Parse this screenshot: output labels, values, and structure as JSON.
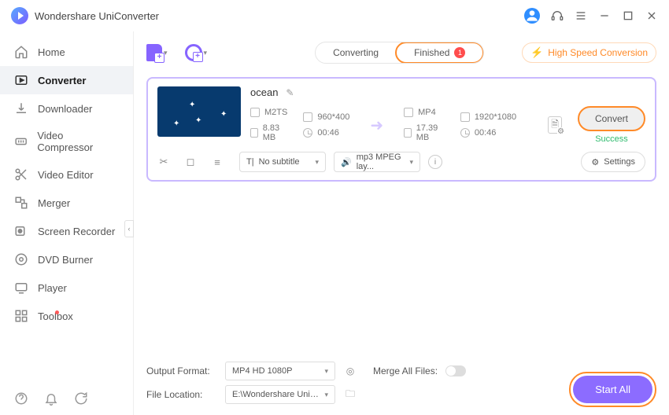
{
  "app": {
    "title": "Wondershare UniConverter"
  },
  "sidebar": {
    "items": [
      {
        "label": "Home"
      },
      {
        "label": "Converter"
      },
      {
        "label": "Downloader"
      },
      {
        "label": "Video Compressor"
      },
      {
        "label": "Video Editor"
      },
      {
        "label": "Merger"
      },
      {
        "label": "Screen Recorder"
      },
      {
        "label": "DVD Burner"
      },
      {
        "label": "Player"
      },
      {
        "label": "Toolbox"
      }
    ]
  },
  "tabs": {
    "converting": "Converting",
    "finished": "Finished",
    "finished_count": "1"
  },
  "hispeed": "High Speed Conversion",
  "file": {
    "name": "ocean",
    "src": {
      "format": "M2TS",
      "res": "960*400",
      "size": "8.83 MB",
      "dur": "00:46"
    },
    "dst": {
      "format": "MP4",
      "res": "1920*1080",
      "size": "17.39 MB",
      "dur": "00:46"
    },
    "subtitle": "No subtitle",
    "audio": "mp3 MPEG lay...",
    "settings": "Settings",
    "convert": "Convert",
    "status": "Success"
  },
  "footer": {
    "output_label": "Output Format:",
    "output_value": "MP4 HD 1080P",
    "location_label": "File Location:",
    "location_value": "E:\\Wondershare UniConverter",
    "merge_label": "Merge All Files:",
    "startall": "Start All"
  }
}
